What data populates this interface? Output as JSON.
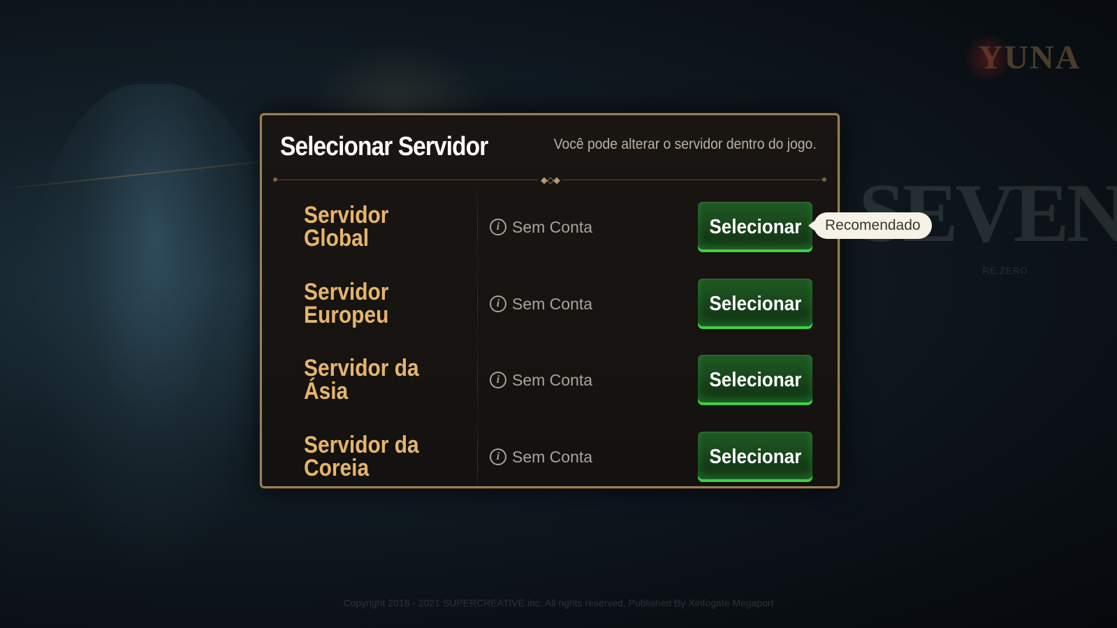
{
  "dialog": {
    "title": "Selecionar Servidor",
    "subtitle": "Você pode alterar o servidor dentro do jogo.",
    "ornament": "◆◇◆"
  },
  "servers": [
    {
      "name": "Servidor Global",
      "status": "Sem Conta",
      "button": "Selecionar",
      "badge": "Recomendado"
    },
    {
      "name": "Servidor Europeu",
      "status": "Sem Conta",
      "button": "Selecionar"
    },
    {
      "name": "Servidor da Ásia",
      "status": "Sem Conta",
      "button": "Selecionar"
    },
    {
      "name": "Servidor da Coreia",
      "status": "Sem Conta",
      "button": "Selecionar"
    }
  ],
  "icons": {
    "status": "info-icon",
    "info_glyph": "i"
  },
  "background": {
    "logo_top": "YUNA",
    "logo_main": "SEVEN",
    "logo_sub": "RE:ZERO",
    "copyright": "Copyright 2018 - 2021 SUPERCREATIVE inc. All rights reserved. Published By Xinfogate Megaport",
    "version": ""
  },
  "colors": {
    "accent_gold": "#e6b56a",
    "panel_border": "#9b8058",
    "button_green": "#17421a",
    "button_glow": "#3fcf45"
  }
}
